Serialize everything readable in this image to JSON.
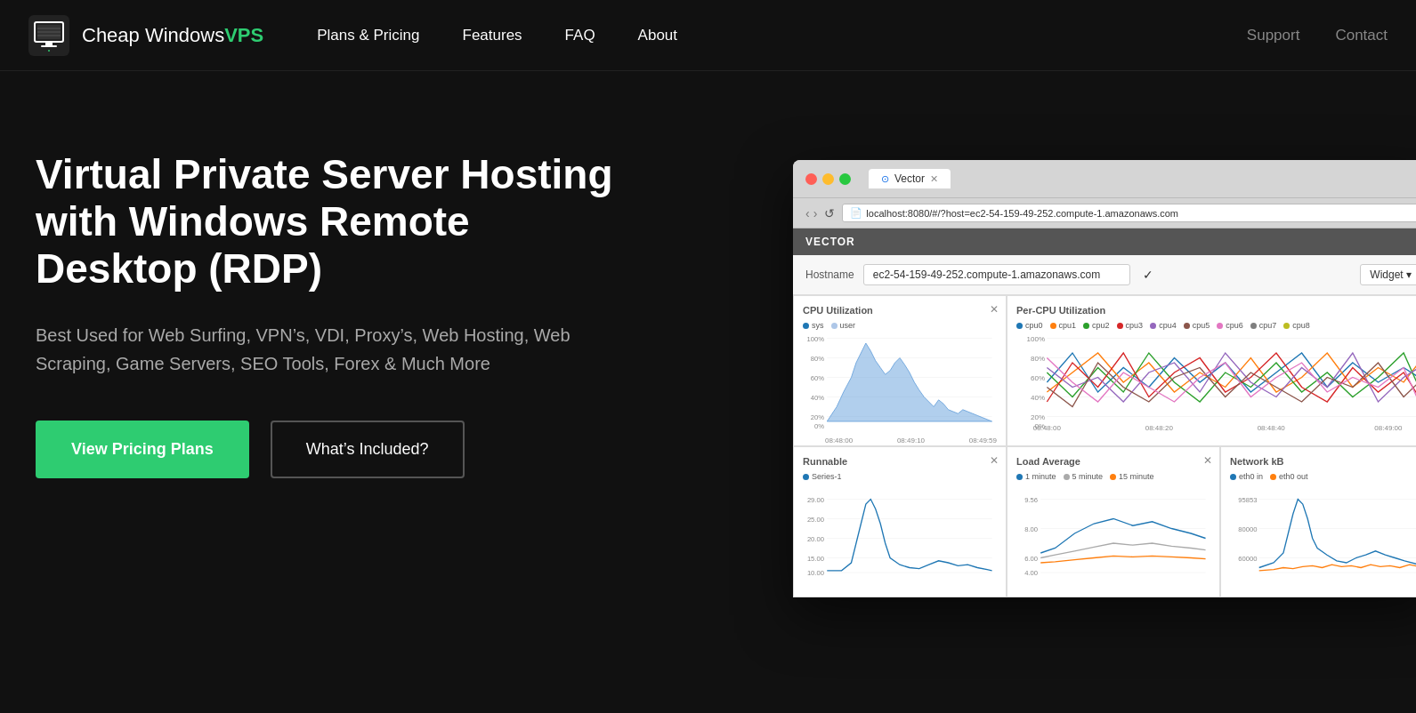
{
  "navbar": {
    "logo": {
      "text_plain": "Cheap Windows",
      "text_colored": "VPS"
    },
    "nav_items": [
      {
        "label": "Plans & Pricing",
        "id": "plans-pricing"
      },
      {
        "label": "Features",
        "id": "features"
      },
      {
        "label": "FAQ",
        "id": "faq"
      },
      {
        "label": "About",
        "id": "about"
      }
    ],
    "nav_right": [
      {
        "label": "Support",
        "id": "support"
      },
      {
        "label": "Contact",
        "id": "contact"
      }
    ]
  },
  "hero": {
    "title": "Virtual Private Server Hosting with Windows Remote Desktop (RDP)",
    "subtitle": "Best Used for Web Surfing, VPN’s, VDI, Proxy’s, Web Hosting, Web Scraping, Game Servers, SEO Tools, Forex & Much More",
    "btn_primary": "View Pricing Plans",
    "btn_secondary": "What’s Included?"
  },
  "browser": {
    "tab_label": "Vector",
    "address": "localhost:8080/#/?host=ec2-54-159-49-252.compute-1.amazonaws.com",
    "vector_header": "VECTOR",
    "hostname_label": "Hostname",
    "hostname_value": "ec2-54-159-49-252.compute-1.amazonaws.com",
    "widget_label": "Widget ▾",
    "charts": [
      {
        "id": "cpu-util",
        "title": "CPU Utilization",
        "legend": [
          {
            "color": "#1f77b4",
            "label": "sys"
          },
          {
            "color": "#aec7e8",
            "label": "user"
          }
        ],
        "x_labels": [
          "08:48:00",
          "08:49:10",
          "08:49:59"
        ]
      },
      {
        "id": "per-cpu-util",
        "title": "Per-CPU Utilization",
        "legend": [
          {
            "color": "#1f77b4",
            "label": "cpu0"
          },
          {
            "color": "#ff7f0e",
            "label": "cpu1"
          },
          {
            "color": "#2ca02c",
            "label": "cpu2"
          },
          {
            "color": "#d62728",
            "label": "cpu3"
          },
          {
            "color": "#9467bd",
            "label": "cpu4"
          },
          {
            "color": "#8c564b",
            "label": "cpu5"
          },
          {
            "color": "#e377c2",
            "label": "cpu6"
          },
          {
            "color": "#7f7f7f",
            "label": "cpu7"
          },
          {
            "color": "#bcbd22",
            "label": "cpu8"
          }
        ],
        "x_labels": [
          "08:48:00",
          "08:48:20",
          "08:48:40",
          "08:49:00"
        ]
      },
      {
        "id": "runnable",
        "title": "Runnable",
        "legend": [
          {
            "color": "#1f77b4",
            "label": "Series-1"
          }
        ],
        "x_labels": [
          "",
          "",
          ""
        ]
      },
      {
        "id": "load-average",
        "title": "Load Average",
        "legend": [
          {
            "color": "#1f77b4",
            "label": "1 minute"
          },
          {
            "color": "#aaa",
            "label": "5 minute"
          },
          {
            "color": "#ff7f0e",
            "label": "15 minute"
          }
        ],
        "y_max": "9.56",
        "x_labels": [
          "",
          "",
          ""
        ]
      },
      {
        "id": "network-kb",
        "title": "Network kB",
        "legend": [
          {
            "color": "#1f77b4",
            "label": "eth0 in"
          },
          {
            "color": "#ff7f0e",
            "label": "eth0 out"
          }
        ],
        "y_max": "95853",
        "x_labels": [
          "",
          "",
          ""
        ]
      }
    ],
    "y_labels": [
      "100%",
      "80%",
      "60%",
      "40%",
      "20%",
      "0%"
    ]
  }
}
